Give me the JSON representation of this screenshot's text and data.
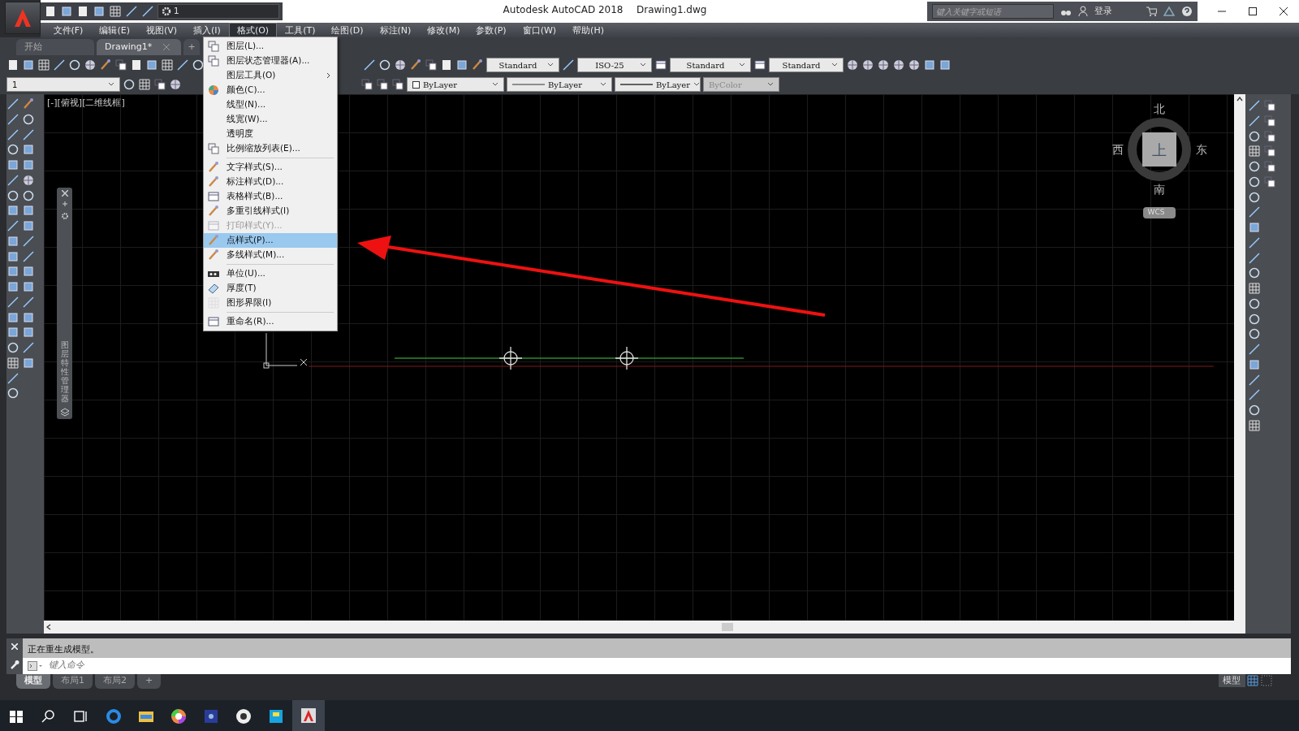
{
  "window": {
    "title": "Autodesk AutoCAD 2018",
    "file": "Drawing1.dwg"
  },
  "quick_access": {
    "workspace": "1"
  },
  "search": {
    "placeholder": "键入关键字或短语"
  },
  "sign_in": "登录",
  "menu_bar": [
    {
      "label": "文件(F)",
      "selected": false
    },
    {
      "label": "编辑(E)",
      "selected": false
    },
    {
      "label": "视图(V)",
      "selected": false
    },
    {
      "label": "插入(I)",
      "selected": false
    },
    {
      "label": "格式(O)",
      "selected": true
    },
    {
      "label": "工具(T)",
      "selected": false
    },
    {
      "label": "绘图(D)",
      "selected": false
    },
    {
      "label": "标注(N)",
      "selected": false
    },
    {
      "label": "修改(M)",
      "selected": false
    },
    {
      "label": "参数(P)",
      "selected": false
    },
    {
      "label": "窗口(W)",
      "selected": false
    },
    {
      "label": "帮助(H)",
      "selected": false
    }
  ],
  "doc_tabs": [
    {
      "label": "开始",
      "selected": false,
      "closable": false
    },
    {
      "label": "Drawing1*",
      "selected": true,
      "closable": true
    }
  ],
  "new_tab": "+",
  "styles": [
    {
      "value": "Standard",
      "disabled": false
    },
    {
      "value": "ISO-25",
      "disabled": false
    },
    {
      "value": "Standard",
      "disabled": false
    },
    {
      "value": "Standard",
      "disabled": false
    }
  ],
  "layer": {
    "value": "1",
    "disabled": false
  },
  "properties": [
    {
      "value": "ByLayer",
      "kind": "color",
      "disabled": false
    },
    {
      "value": "ByLayer",
      "kind": "linetype",
      "disabled": false
    },
    {
      "value": "ByLayer",
      "kind": "lineweight",
      "disabled": false
    },
    {
      "value": "ByColor",
      "kind": "plot",
      "disabled": true
    }
  ],
  "format_menu": {
    "groups": [
      [
        {
          "label": "图层(L)...",
          "selected": false,
          "disabled": false,
          "submenu": false
        },
        {
          "label": "图层状态管理器(A)...",
          "selected": false,
          "disabled": false,
          "submenu": false
        },
        {
          "label": "图层工具(O)",
          "selected": false,
          "disabled": false,
          "submenu": true
        },
        {
          "label": "颜色(C)...",
          "selected": false,
          "disabled": false,
          "submenu": false
        },
        {
          "label": "线型(N)...",
          "selected": false,
          "disabled": false,
          "submenu": false
        },
        {
          "label": "线宽(W)...",
          "selected": false,
          "disabled": false,
          "submenu": false
        },
        {
          "label": "透明度",
          "selected": false,
          "disabled": false,
          "submenu": false
        },
        {
          "label": "比例缩放列表(E)...",
          "selected": false,
          "disabled": false,
          "submenu": false
        }
      ],
      [
        {
          "label": "文字样式(S)...",
          "selected": false,
          "disabled": false,
          "submenu": false
        },
        {
          "label": "标注样式(D)...",
          "selected": false,
          "disabled": false,
          "submenu": false
        },
        {
          "label": "表格样式(B)...",
          "selected": false,
          "disabled": false,
          "submenu": false
        },
        {
          "label": "多重引线样式(I)",
          "selected": false,
          "disabled": false,
          "submenu": false
        },
        {
          "label": "打印样式(Y)...",
          "selected": false,
          "disabled": true,
          "submenu": false
        },
        {
          "label": "点样式(P)...",
          "selected": true,
          "disabled": false,
          "submenu": false
        },
        {
          "label": "多线样式(M)...",
          "selected": false,
          "disabled": false,
          "submenu": false
        }
      ],
      [
        {
          "label": "单位(U)...",
          "selected": false,
          "disabled": false,
          "submenu": false
        },
        {
          "label": "厚度(T)",
          "selected": false,
          "disabled": false,
          "submenu": false
        },
        {
          "label": "图形界限(I)",
          "selected": false,
          "disabled": false,
          "submenu": false
        }
      ],
      [
        {
          "label": "重命名(R)...",
          "selected": false,
          "disabled": false,
          "submenu": false
        }
      ]
    ]
  },
  "viewport_label": "[-][俯视][二维线框]",
  "palette": {
    "title": "图层特性管理器"
  },
  "compass": {
    "north": "北",
    "south": "南",
    "east": "东",
    "west": "西",
    "face": "上",
    "ucs": "WCS"
  },
  "command": {
    "history": "正在重生成模型。",
    "placeholder": "键入命令"
  },
  "layout_tabs": [
    {
      "label": "模型",
      "selected": true
    },
    {
      "label": "布局1",
      "selected": false
    },
    {
      "label": "布局2",
      "selected": false
    }
  ],
  "add_layout": "+",
  "status_bar": {
    "space": "模型"
  },
  "taskbar_apps": [
    {
      "selected": false
    },
    {
      "selected": false
    },
    {
      "selected": false
    },
    {
      "selected": false
    },
    {
      "selected": false
    },
    {
      "selected": false
    },
    {
      "selected": true
    }
  ]
}
